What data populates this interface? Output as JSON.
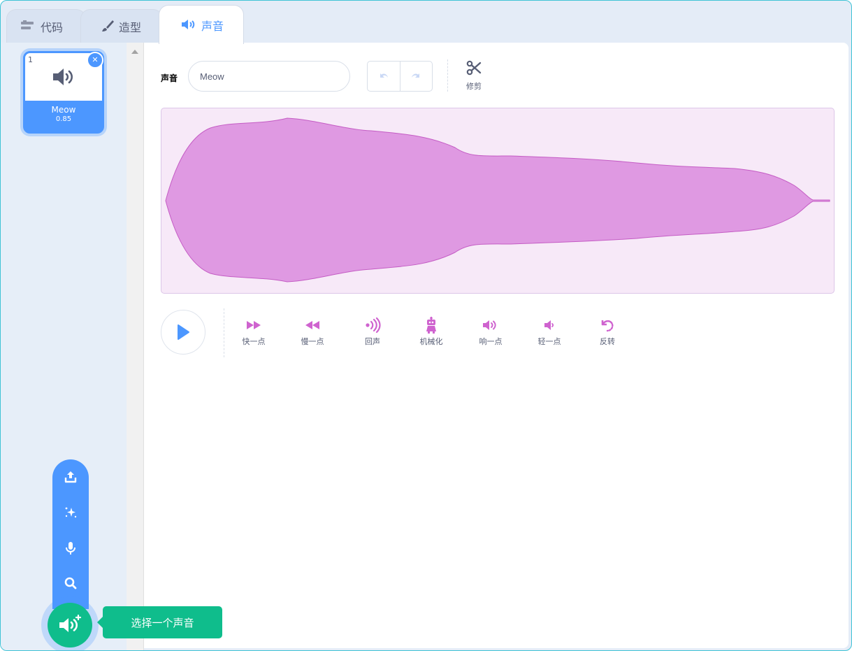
{
  "tabs": [
    {
      "label": "代码",
      "icon": "code-blocks-icon"
    },
    {
      "label": "造型",
      "icon": "brush-icon"
    },
    {
      "label": "声音",
      "icon": "speaker-icon",
      "active": true
    }
  ],
  "sound_list": [
    {
      "index": "1",
      "name": "Meow",
      "duration": "0.85",
      "selected": true
    }
  ],
  "editor": {
    "sound_label": "声音",
    "sound_name": "Meow",
    "trim_label": "修剪",
    "effects": [
      {
        "label": "快一点",
        "icon": "faster-icon"
      },
      {
        "label": "慢一点",
        "icon": "slower-icon"
      },
      {
        "label": "回声",
        "icon": "echo-icon"
      },
      {
        "label": "机械化",
        "icon": "robot-icon"
      },
      {
        "label": "响一点",
        "icon": "louder-icon"
      },
      {
        "label": "轻一点",
        "icon": "softer-icon"
      },
      {
        "label": "反转",
        "icon": "reverse-icon"
      }
    ]
  },
  "add_sound_tooltip": "选择一个声音",
  "colors": {
    "accent": "#4c97ff",
    "sound_purple": "#cf63cf",
    "wave_fill": "#df99e2",
    "add_green": "#0fbd8c"
  }
}
